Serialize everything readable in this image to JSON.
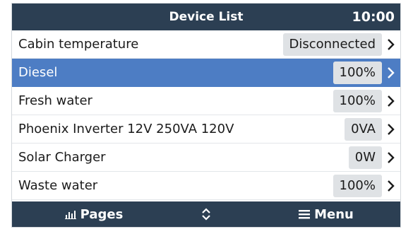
{
  "header": {
    "title": "Device List",
    "clock": "10:00"
  },
  "colors": {
    "header_bg": "#2c3f53",
    "selected_bg": "#4d7dc4",
    "value_bg": "#dfe2e5"
  },
  "devices": [
    {
      "label": "Cabin temperature",
      "value": "Disconnected",
      "selected": false
    },
    {
      "label": "Diesel",
      "value": "100%",
      "selected": true
    },
    {
      "label": "Fresh water",
      "value": "100%",
      "selected": false
    },
    {
      "label": "Phoenix Inverter 12V 250VA 120V",
      "value": "0VA",
      "selected": false
    },
    {
      "label": "Solar Charger",
      "value": "0W",
      "selected": false
    },
    {
      "label": "Waste water",
      "value": "100%",
      "selected": false
    }
  ],
  "footer": {
    "pages_label": "Pages",
    "pages_icon": "bar-chart-icon",
    "updown_icon": "up-down-chevron-icon",
    "menu_label": "Menu",
    "menu_icon": "hamburger-icon"
  }
}
